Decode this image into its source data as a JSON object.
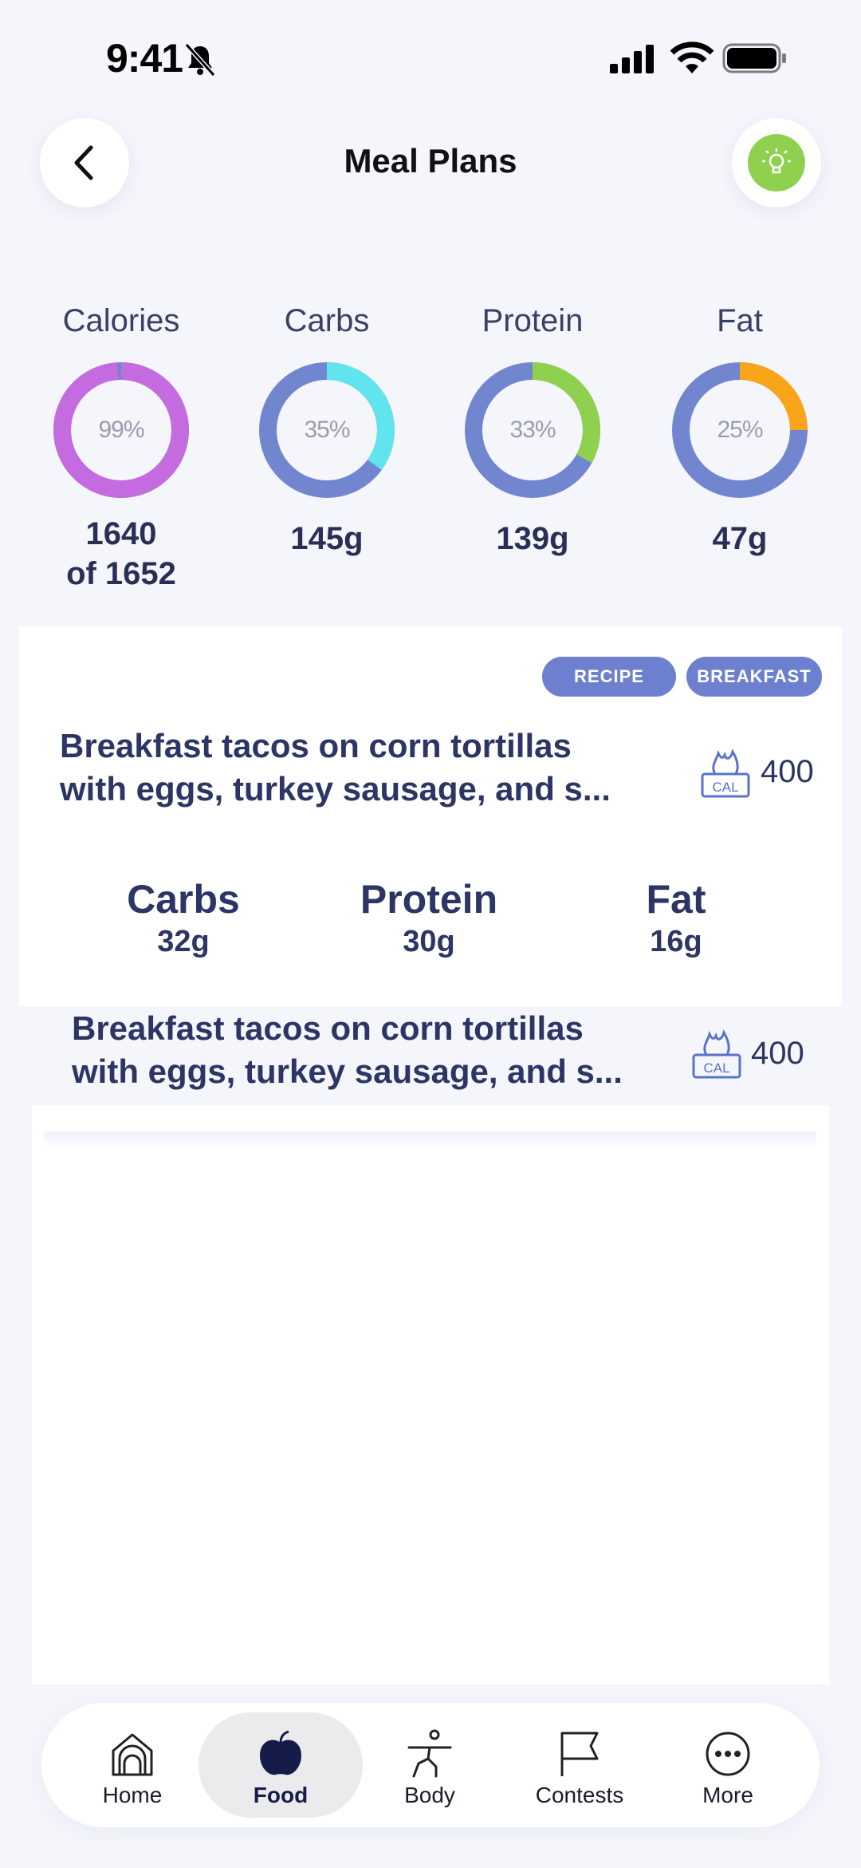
{
  "status_bar": {
    "time": "9:41"
  },
  "header": {
    "title": "Meal Plans"
  },
  "macros": [
    {
      "label": "Calories",
      "percent_text": "99%",
      "percent": 99,
      "value_line1": "1640",
      "value_line2": "of 1652",
      "color": "#c46be0"
    },
    {
      "label": "Carbs",
      "percent_text": "35%",
      "percent": 35,
      "value_line1": "145g",
      "value_line2": "",
      "color": "#62e4ee"
    },
    {
      "label": "Protein",
      "percent_text": "33%",
      "percent": 33,
      "value_line1": "139g",
      "value_line2": "",
      "color": "#8fd14f"
    },
    {
      "label": "Fat",
      "percent_text": "25%",
      "percent": 25,
      "value_line1": "47g",
      "value_line2": "",
      "color": "#f9a51a"
    }
  ],
  "ring_track_color": "#7186cf",
  "meal_card": {
    "tags": [
      "RECIPE",
      "BREAKFAST"
    ],
    "title_line1": "Breakfast tacos on corn tortillas",
    "title_line2": "with eggs, turkey sausage, and s...",
    "calories": "400",
    "cal_icon_text": "CAL",
    "nutrients": [
      {
        "label": "Carbs",
        "value": "32g"
      },
      {
        "label": "Protein",
        "value": "30g"
      },
      {
        "label": "Fat",
        "value": "16g"
      }
    ]
  },
  "meal_item_2": {
    "title_line1": "Breakfast tacos on corn tortillas",
    "title_line2": "with eggs, turkey sausage, and s...",
    "calories": "400",
    "cal_icon_text": "CAL"
  },
  "tabs": [
    {
      "label": "Home",
      "icon": "home-icon"
    },
    {
      "label": "Food",
      "icon": "apple-icon",
      "active": true
    },
    {
      "label": "Body",
      "icon": "body-icon"
    },
    {
      "label": "Contests",
      "icon": "flag-icon"
    },
    {
      "label": "More",
      "icon": "more-icon"
    }
  ]
}
